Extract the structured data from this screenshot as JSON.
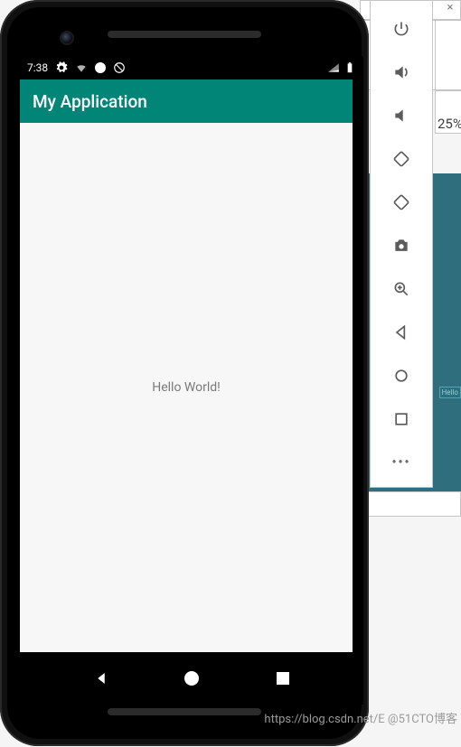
{
  "status_bar": {
    "time": "7:38"
  },
  "app": {
    "title": "My Application",
    "greeting": "Hello World!"
  },
  "side_panel": {
    "zoom_label": "25%"
  },
  "bg": {
    "preview_label": "Hello"
  },
  "watermark": {
    "text": "https://blog.csdn.net/E @51CTO博客"
  },
  "icons": {
    "power": "power-icon",
    "vol_up": "volume-up-icon",
    "vol_down": "volume-down-icon",
    "rotate_left": "rotate-left-icon",
    "rotate_right": "rotate-right-icon",
    "camera": "camera-icon",
    "zoom_in": "zoom-in-icon",
    "back": "back-icon",
    "home": "home-icon",
    "overview": "overview-icon",
    "more": "more-icon"
  }
}
